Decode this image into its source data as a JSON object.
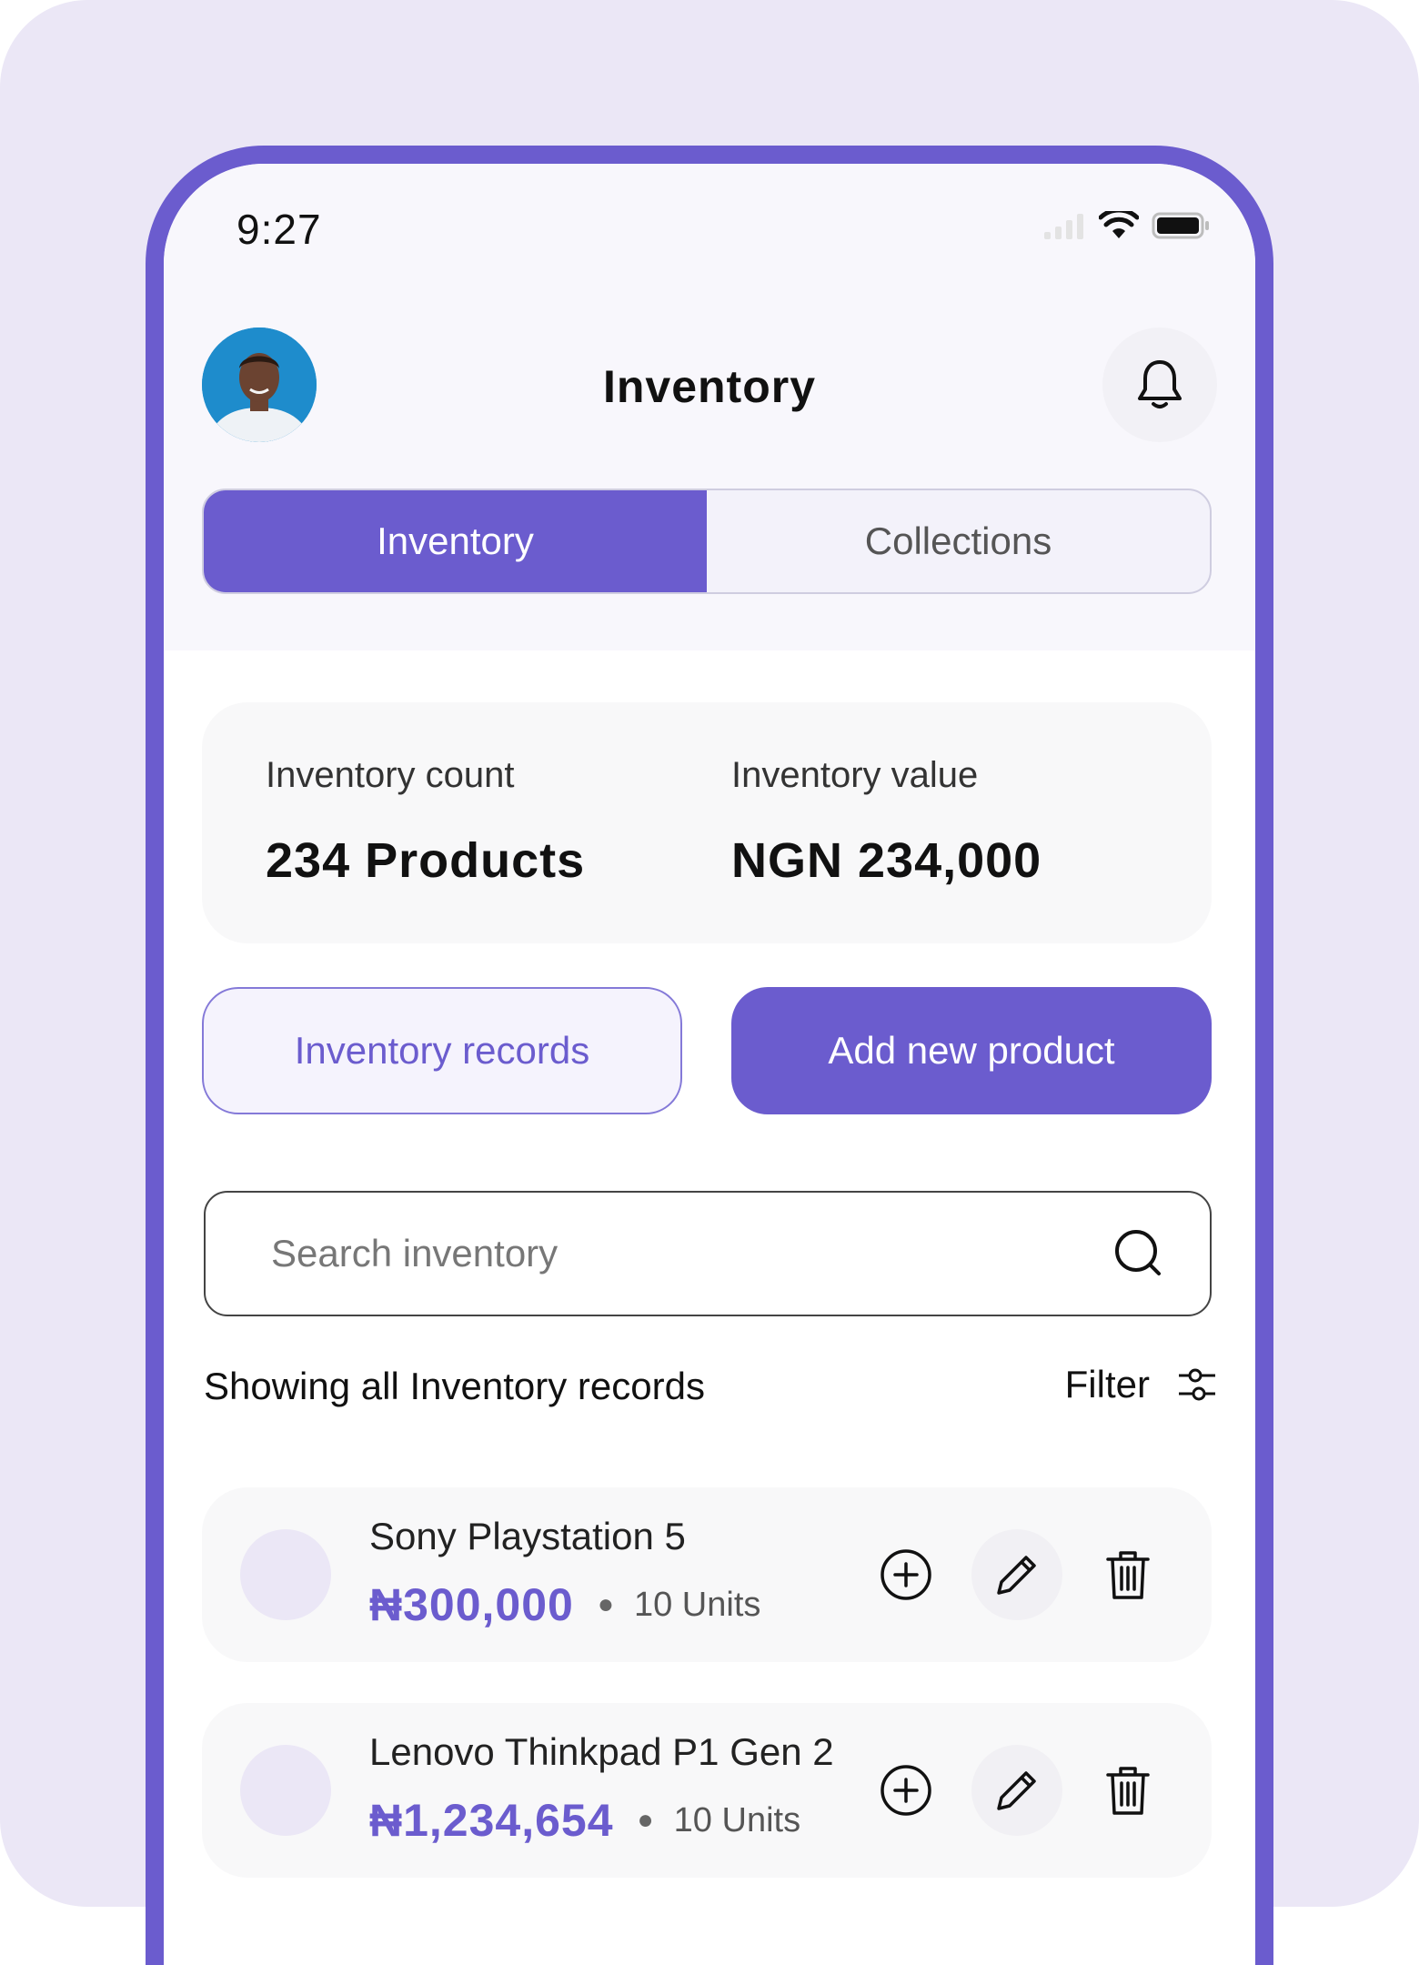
{
  "status_bar": {
    "time": "9:27"
  },
  "header": {
    "title": "Inventory"
  },
  "tabs": [
    {
      "label": "Inventory",
      "active": true
    },
    {
      "label": "Collections",
      "active": false
    }
  ],
  "stats": {
    "count_label": "Inventory count",
    "count_value": "234 Products",
    "value_label": "Inventory value",
    "value_value": "NGN 234,000"
  },
  "actions": {
    "records_label": "Inventory records",
    "add_label": "Add new product"
  },
  "search": {
    "placeholder": "Search inventory",
    "value": ""
  },
  "list": {
    "caption": "Showing all Inventory records",
    "filter_label": "Filter",
    "items": [
      {
        "name": "Sony Playstation 5",
        "price": "₦300,000",
        "units": "10 Units"
      },
      {
        "name": "Lenovo Thinkpad P1 Gen 2",
        "price": "₦1,234,654",
        "units": "10 Units"
      }
    ]
  },
  "colors": {
    "accent": "#6b5cce",
    "background": "#ebe7f6",
    "card": "#f8f8f9"
  }
}
